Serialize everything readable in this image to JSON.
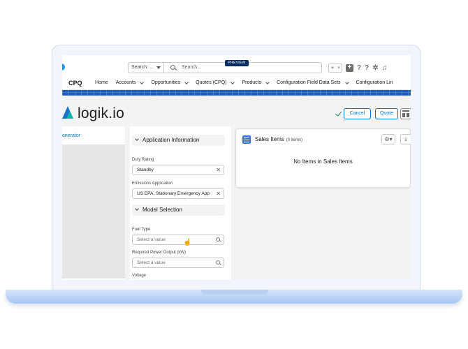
{
  "search": {
    "scope_label": "Search: ...",
    "placeholder": "Search...",
    "preview_badge": "PREVIEW"
  },
  "header_icons": [
    "favorites-icon",
    "add-icon",
    "help-icon",
    "help-icon",
    "setup-gear-icon",
    "notifications-bell-icon"
  ],
  "nav": {
    "app_name": "CPQ",
    "items": [
      {
        "label": "Home",
        "has_menu": false
      },
      {
        "label": "Accounts",
        "has_menu": true
      },
      {
        "label": "Opportunities",
        "has_menu": true
      },
      {
        "label": "Quotes (CPQ)",
        "has_menu": true
      },
      {
        "label": "Products",
        "has_menu": true
      },
      {
        "label": "Configuration Field Data Sets",
        "has_menu": true
      },
      {
        "label": "Configuration Lin",
        "has_menu": false
      }
    ]
  },
  "brand": {
    "logo_text": "logik.io",
    "accent_color": "#0176d3"
  },
  "actions": {
    "cancel_label": "Cancel",
    "quote_label": "Quote"
  },
  "left_panel": {
    "link_text": "enerator"
  },
  "form": {
    "section_application": "Application Information",
    "duty_rating": {
      "label": "Duty Rating",
      "value": "Standby"
    },
    "emissions_application": {
      "label": "Emissions Application",
      "value": "US EPA, Stationary Emergency App"
    },
    "section_model": "Model Selection",
    "fuel_type": {
      "label": "Fuel Type",
      "placeholder": "Select a value"
    },
    "required_power_output": {
      "label": "Required Power Output (kW)",
      "placeholder": "Select a value"
    },
    "voltage": {
      "label": "Voltage"
    }
  },
  "sales_items": {
    "title": "Sales Items",
    "count_text": "(0 items)",
    "empty_message": "No Items in Sales Items"
  }
}
